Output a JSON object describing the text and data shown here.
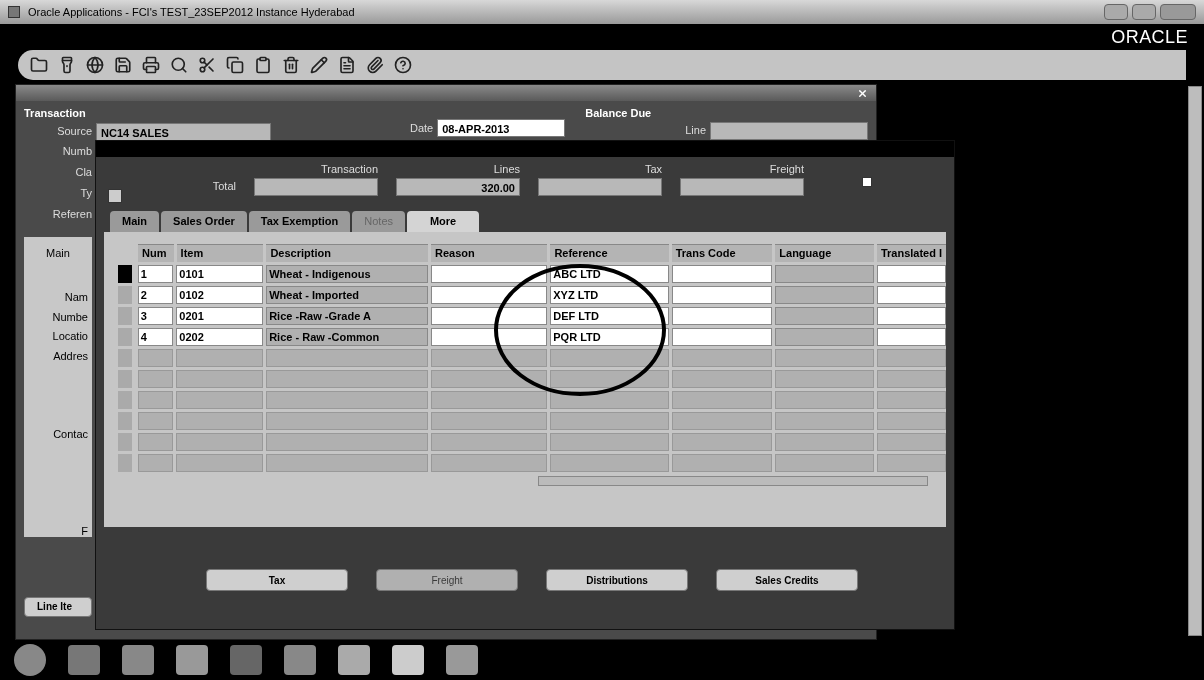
{
  "window": {
    "title": "Oracle Applications - FCI's TEST_23SEP2012 Instance Hyderabad"
  },
  "brand": "ORACLE",
  "transactions_window": {
    "section": "Transaction",
    "source": {
      "label": "Source",
      "value": "NC14 SALES"
    },
    "date": {
      "label": "Date",
      "value": "08-APR-2013"
    },
    "balance_due": {
      "title": "Balance Due",
      "label": "Line"
    },
    "side_labels": [
      "Numb",
      "Cla",
      "Ty",
      "Referen"
    ],
    "panel_title": "Main",
    "panel_labels": [
      {
        "text": "Nam",
        "kind": "field"
      },
      {
        "text": "Numbe",
        "kind": "field"
      },
      {
        "text": "Locatio",
        "kind": "field"
      },
      {
        "text": "Addres",
        "kind": "field"
      },
      {
        "text": "Contac",
        "kind": "contact"
      },
      {
        "text": "F",
        "kind": "footer"
      }
    ],
    "line_items_button": "Line Ite"
  },
  "lines_window": {
    "total_label": "Total",
    "totals": [
      {
        "heading": "Transaction"
      },
      {
        "heading": "Lines",
        "value": "320.00"
      },
      {
        "heading": "Tax"
      },
      {
        "heading": "Freight"
      }
    ],
    "tabs": [
      {
        "label": "Main",
        "selected": false,
        "disabled": false
      },
      {
        "label": "Sales Order",
        "selected": false,
        "disabled": false
      },
      {
        "label": "Tax Exemption",
        "selected": false,
        "disabled": false
      },
      {
        "label": "Notes",
        "selected": false,
        "disabled": true
      },
      {
        "label": "More",
        "selected": true,
        "disabled": false
      }
    ],
    "columns": [
      "Num",
      "Item",
      "Description",
      "Reason",
      "Reference",
      "Trans Code",
      "Language",
      "Translated I"
    ],
    "rows": [
      {
        "num": "1",
        "item": "0101",
        "description": "Wheat - Indigenous",
        "reference": "ABC LTD",
        "selected": true
      },
      {
        "num": "2",
        "item": "0102",
        "description": "Wheat - Imported",
        "reference": "XYZ LTD",
        "selected": false
      },
      {
        "num": "3",
        "item": "0201",
        "description": "Rice -Raw -Grade A",
        "reference": "DEF LTD",
        "selected": false
      },
      {
        "num": "4",
        "item": "0202",
        "description": "Rice - Raw -Common",
        "reference": "PQR LTD",
        "selected": false
      }
    ],
    "buttons": [
      {
        "label": "Tax",
        "disabled": false
      },
      {
        "label": "Freight",
        "disabled": true
      },
      {
        "label": "Distributions",
        "disabled": false
      },
      {
        "label": "Sales Credits",
        "disabled": false
      }
    ]
  }
}
